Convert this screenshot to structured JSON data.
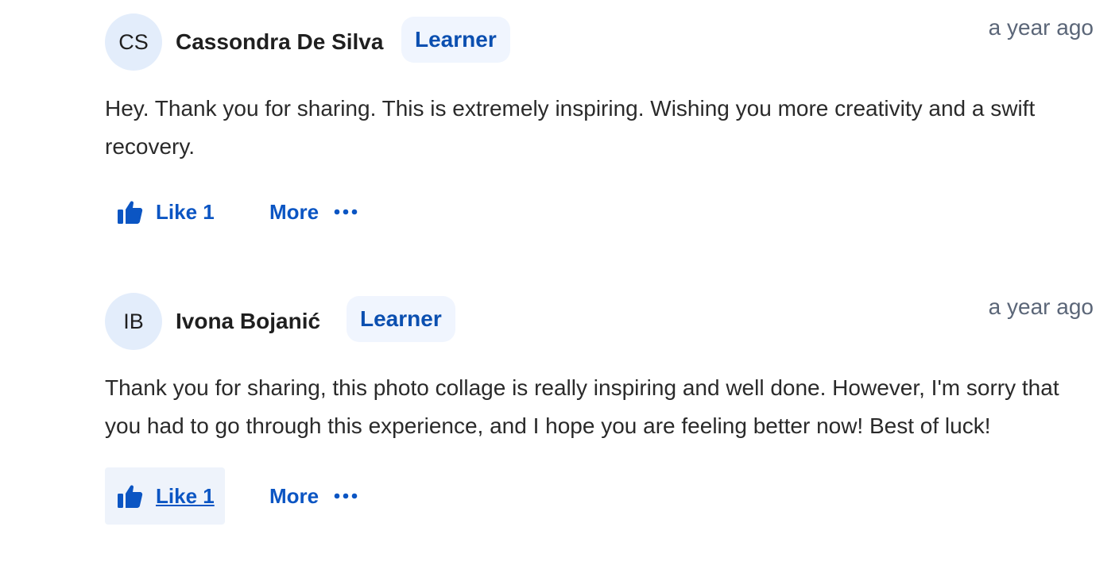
{
  "comments": [
    {
      "avatar_initials": "CS",
      "author": "Cassondra De Silva",
      "badge": "Learner",
      "timestamp": "a year ago",
      "text": "Hey. Thank you for sharing. This is extremely inspiring. Wishing you more creativity and a swift recovery.",
      "like_label": "Like 1",
      "more_label": "More",
      "like_hovered": false
    },
    {
      "avatar_initials": "IB",
      "author": "Ivona Bojanić",
      "badge": "Learner",
      "timestamp": "a year ago",
      "text": "Thank you for sharing, this photo collage is really inspiring and well done. However, I'm sorry that you had to go through this experience, and I hope you are feeling better now! Best of luck!",
      "like_label": "Like 1",
      "more_label": "More",
      "like_hovered": true
    }
  ],
  "icons": {
    "like": "thumbs-up-icon",
    "more": "ellipsis-icon"
  },
  "colors": {
    "accent": "#0b55c3",
    "badge_bg": "#f0f5fe",
    "badge_text": "#0b4fb0",
    "avatar_bg": "#e3edfb",
    "timestamp": "#5b6678"
  }
}
